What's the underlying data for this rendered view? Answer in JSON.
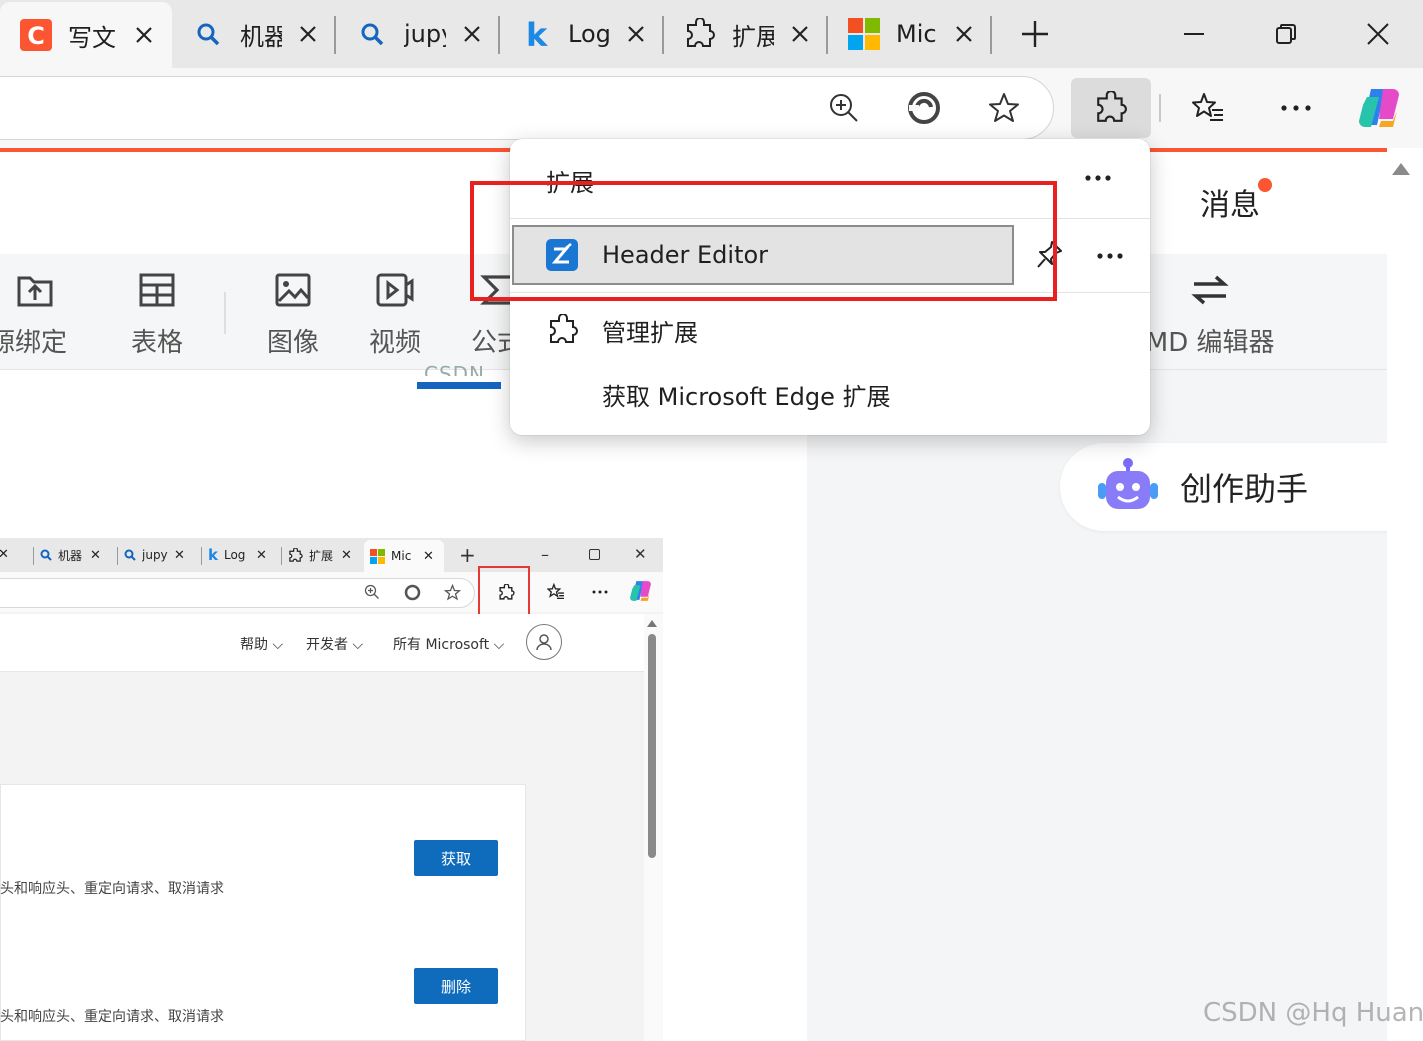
{
  "browser": {
    "tabs": [
      {
        "title": "写文章",
        "icon": "csdn-logo-icon",
        "active": true
      },
      {
        "title": "机器学习",
        "icon": "search-icon"
      },
      {
        "title": "jupyter",
        "icon": "search-icon"
      },
      {
        "title": "Login",
        "icon": "k-logo-icon"
      },
      {
        "title": "扩展",
        "icon": "puzzle-icon"
      },
      {
        "title": "Microsoft",
        "icon": "microsoft-logo-icon"
      }
    ],
    "new_tab_icon": "plus-icon",
    "window_controls": [
      "minimize-icon",
      "restore-icon",
      "close-icon"
    ]
  },
  "page": {
    "messages_label": "消息",
    "editor_tools": [
      {
        "label": "资源绑定",
        "icon": "upload-folder-icon"
      },
      {
        "label": "表格",
        "icon": "table-icon"
      },
      {
        "label": "图像",
        "icon": "image-icon"
      },
      {
        "label": "视频",
        "icon": "video-icon"
      },
      {
        "label": "公式",
        "icon": "sigma-icon"
      },
      {
        "label": "使用 MD 编辑器",
        "icon": "swap-icon"
      }
    ],
    "tab_ghost": "CSDN",
    "assistant_label": "创作助手",
    "watermark": "CSDN @Hq Huang"
  },
  "flyout": {
    "title": "扩展",
    "extension_name": "Header Editor",
    "manage_label": "管理扩展",
    "get_label": "获取 Microsoft Edge 扩展"
  },
  "embed": {
    "tabs": [
      {
        "title": "机器",
        "icon": "search-icon"
      },
      {
        "title": "jupy",
        "icon": "search-icon"
      },
      {
        "title": "Log",
        "icon": "k-logo-icon"
      },
      {
        "title": "扩展",
        "icon": "puzzle-icon"
      },
      {
        "title": "Mic",
        "icon": "microsoft-logo-icon",
        "active": true
      }
    ],
    "nav": {
      "help": "帮助",
      "developer": "开发者",
      "all_microsoft": "所有 Microsoft"
    },
    "desc1": "头和响应头、重定向请求、取消请求",
    "desc2": "头和响应头、重定向请求、取消请求",
    "get_button": "获取",
    "remove_button": "删除"
  },
  "colors": {
    "accent_red": "#fc5531",
    "edge_blue": "#0f6cbd",
    "annotation_red": "#e8201f"
  }
}
